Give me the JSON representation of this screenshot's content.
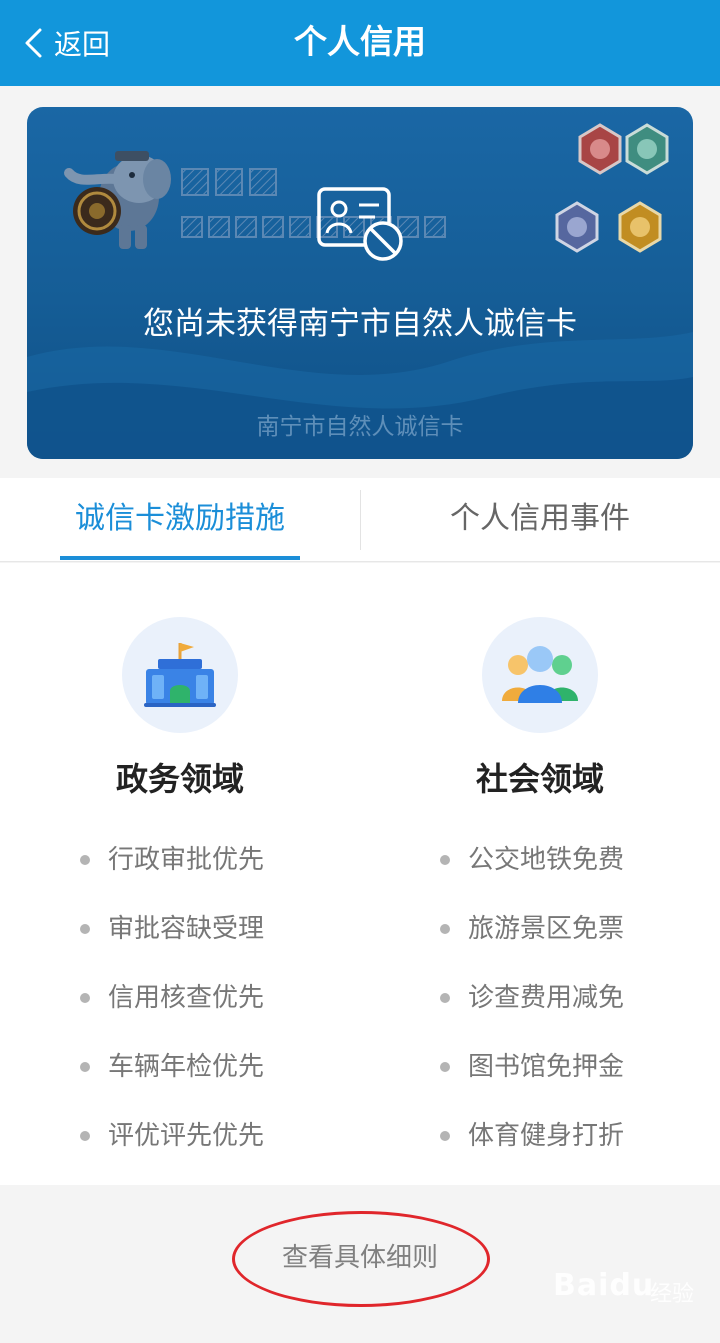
{
  "header": {
    "back_label": "返回",
    "title": "个人信用",
    "color": "#1296db"
  },
  "card": {
    "message": "您尚未获得南宁市自然人诚信卡",
    "footer_label": "南宁市自然人诚信卡",
    "badge_colors": [
      "#b84a4a",
      "#4a9a8c",
      "#5b6ca8",
      "#c9962a"
    ]
  },
  "tabs": [
    {
      "label": "诚信卡激励措施",
      "active": true
    },
    {
      "label": "个人信用事件",
      "active": false
    }
  ],
  "sections": {
    "government": {
      "title": "政务领域",
      "icon": "government-building-icon",
      "items": [
        "行政审批优先",
        "审批容缺受理",
        "信用核查优先",
        "车辆年检优先",
        "评优评先优先"
      ]
    },
    "social": {
      "title": "社会领域",
      "icon": "people-group-icon",
      "items": [
        "公交地铁免费",
        "旅游景区免票",
        "诊查费用减免",
        "图书馆免押金",
        "体育健身打折"
      ]
    }
  },
  "footer": {
    "detail_link": "查看具体细则"
  },
  "watermark": {
    "text": "Baidu",
    "cn": "经验"
  },
  "colors": {
    "accent": "#1b8ed8",
    "annotation": "#e0262b"
  }
}
